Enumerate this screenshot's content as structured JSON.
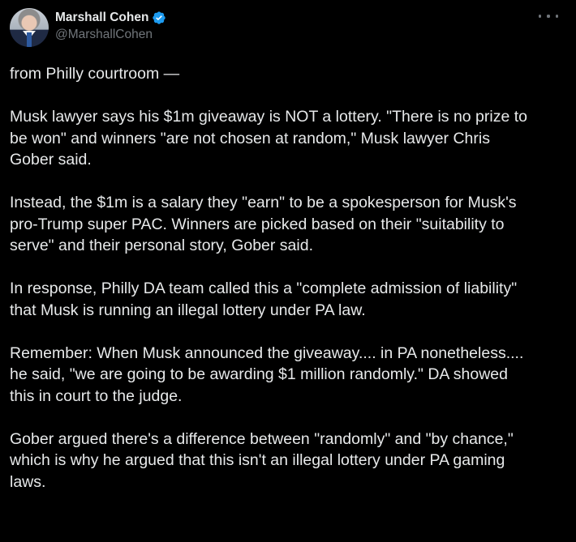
{
  "author": {
    "display_name": "Marshall Cohen",
    "handle": "@MarshallCohen",
    "verified_icon": "verified-badge-icon",
    "verified_color": "#1d9bf0"
  },
  "menu": {
    "icon": "more-options-icon"
  },
  "tweet": {
    "paragraphs": [
      "from Philly courtroom —",
      "Musk lawyer says his $1m giveaway is NOT a lottery. \"There is no prize to\nbe won\" and winners \"are not chosen at random,\" Musk lawyer Chris\nGober said.",
      "Instead, the $1m is a salary they \"earn\" to be a spokesperson for Musk's\npro-Trump super PAC. Winners are picked based on their \"suitability to\nserve\" and their personal story, Gober said.",
      "In response, Philly DA team called this a \"complete admission of liability\"\nthat Musk is running an illegal lottery under PA law.",
      "Remember: When Musk announced the giveaway.... in PA nonetheless....\nhe said, \"we are going to be awarding $1 million randomly.\" DA showed\nthis in court to the judge.",
      "Gober argued there's a difference between \"randomly\" and \"by chance,\"\nwhich is why he argued that this isn't an illegal lottery under PA gaming\nlaws."
    ]
  },
  "colors": {
    "background": "#000000",
    "text": "#e7e9ea",
    "secondary_text": "#71767b"
  }
}
